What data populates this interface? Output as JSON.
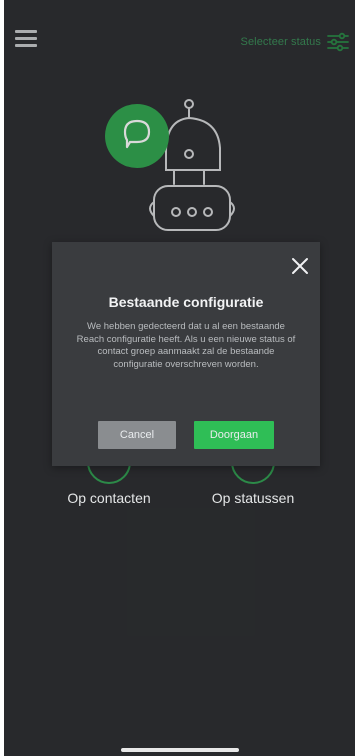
{
  "header": {
    "menu_icon": "hamburger-menu-icon",
    "status_label": "Selecteer status",
    "status_icon": "sliders-icon"
  },
  "illustration": {
    "icon": "robot-chat-icon"
  },
  "options": [
    {
      "label": "Op contacten"
    },
    {
      "label": "Op statussen"
    }
  ],
  "dialog": {
    "close_icon": "close-icon",
    "title": "Bestaande configuratie",
    "message": "We hebben gedecteerd dat u al een bestaande Reach configuratie heeft. Als u een nieuwe status of contact groep aanmaakt zal de bestaande configuratie overschreven worden.",
    "cancel_label": "Cancel",
    "continue_label": "Doorgaan"
  },
  "colors": {
    "background": "#2f3134",
    "accent": "#2fbe56",
    "dialog_bg": "#3a3c3f",
    "cancel_bg": "#8a8d90"
  }
}
